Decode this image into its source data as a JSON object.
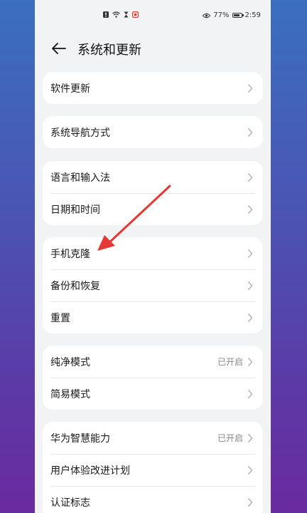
{
  "status": {
    "battery": "77%",
    "time": "2:59"
  },
  "header": {
    "title": "系统和更新"
  },
  "groups": [
    {
      "items": [
        {
          "label": "软件更新"
        }
      ]
    },
    {
      "items": [
        {
          "label": "系统导航方式"
        }
      ]
    },
    {
      "items": [
        {
          "label": "语言和输入法"
        },
        {
          "label": "日期和时间"
        }
      ]
    },
    {
      "items": [
        {
          "label": "手机克隆"
        },
        {
          "label": "备份和恢复"
        },
        {
          "label": "重置"
        }
      ]
    },
    {
      "items": [
        {
          "label": "纯净模式",
          "value": "已开启"
        },
        {
          "label": "简易模式"
        }
      ]
    },
    {
      "items": [
        {
          "label": "华为智慧能力",
          "value": "已开启"
        },
        {
          "label": "用户体验改进计划"
        },
        {
          "label": "认证标志"
        }
      ]
    }
  ],
  "annotation": {
    "color": "#e53935",
    "icon": "red-arrow"
  }
}
